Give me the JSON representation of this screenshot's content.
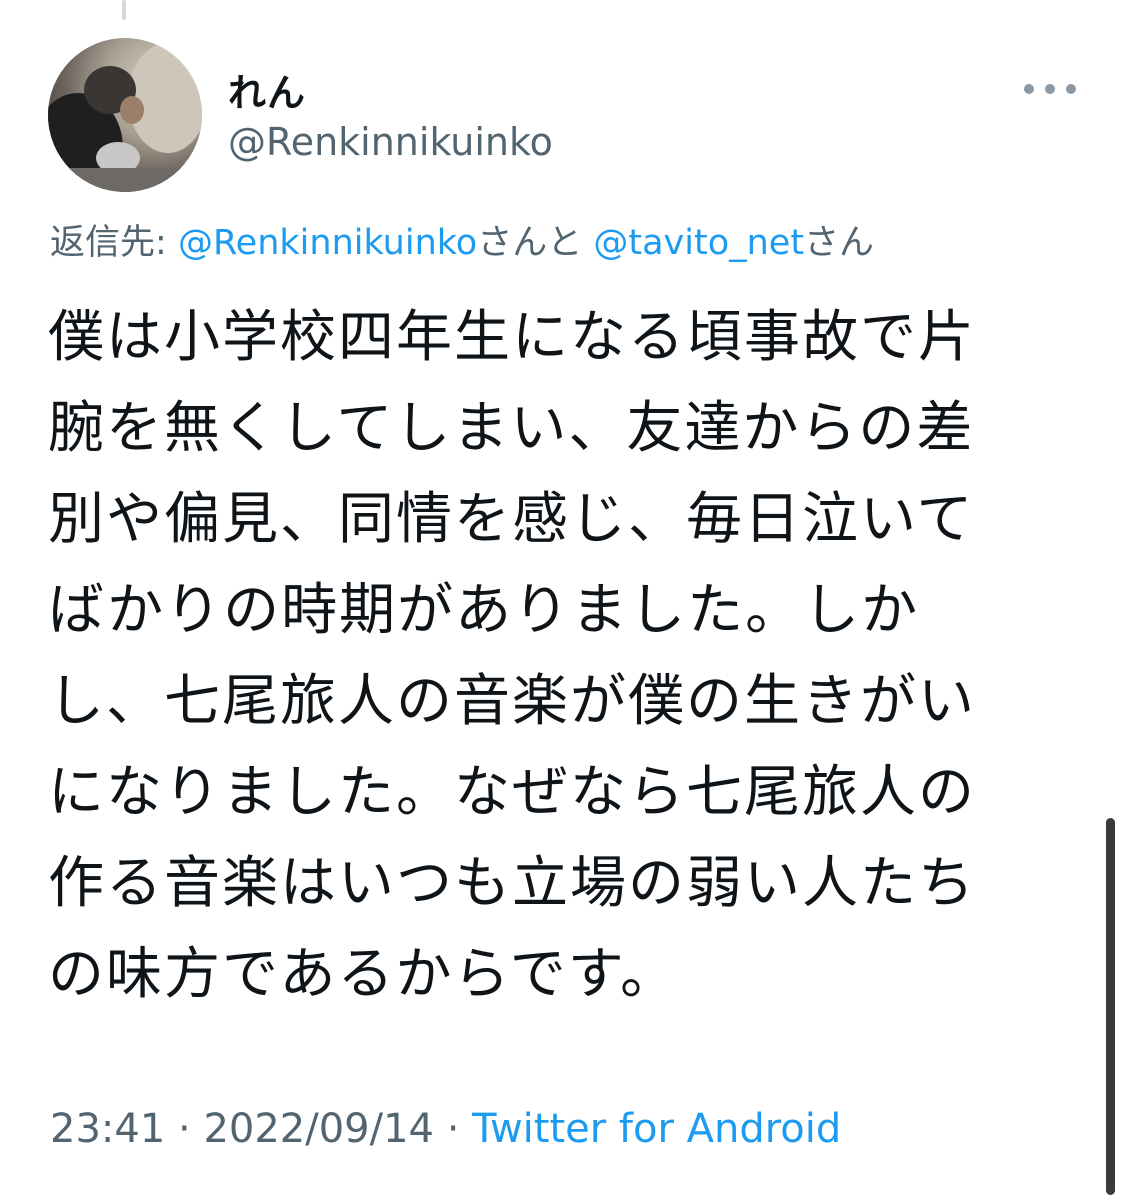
{
  "tweet": {
    "display_name": "れん",
    "handle": "@Renkinnikuinko",
    "reply_to": {
      "label": "返信先:",
      "mention_1": "@Renkinnikuinko",
      "joiner": "さんと",
      "mention_2": "@tavito_net",
      "suffix": "さん"
    },
    "text_lines": [
      "僕は小学校四年生になる頃事故で片",
      "腕を無くしてしまい、友達からの差",
      "別や偏見、同情を感じ、毎日泣いて",
      "ばかりの時期がありました。しか",
      "し、七尾旅人の音楽が僕の生きがい",
      "になりました。なぜなら七尾旅人の",
      "作る音楽はいつも立場の弱い人たち",
      "の味方であるからです。"
    ],
    "time": "23:41",
    "separator": "·",
    "date": "2022/09/14",
    "source": "Twitter for Android"
  },
  "icons": {
    "more": "more-horizontal-icon"
  },
  "colors": {
    "text": "#0f1419",
    "secondary": "#536471",
    "link": "#1d9bf0"
  }
}
